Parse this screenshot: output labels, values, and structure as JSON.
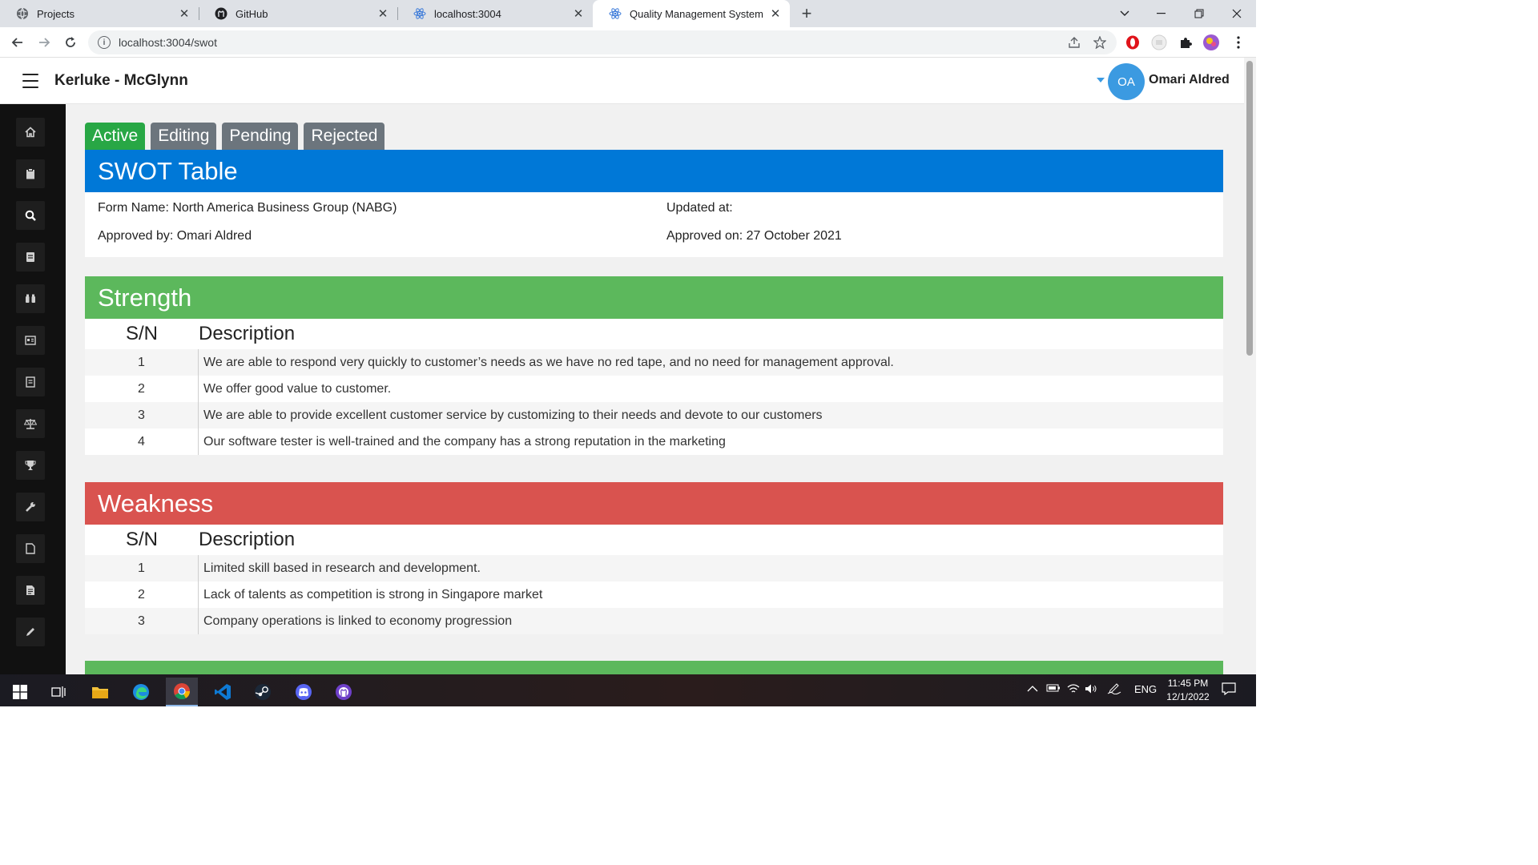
{
  "browser": {
    "tabs": [
      {
        "title": "Projects",
        "icon": "globe-icon"
      },
      {
        "title": "GitHub",
        "icon": "github-icon"
      },
      {
        "title": "localhost:3004",
        "icon": "react-icon"
      },
      {
        "title": "Quality Management System",
        "icon": "react-icon"
      }
    ],
    "close_glyph": "✕",
    "new_tab_glyph": "+",
    "url": "localhost:3004/swot"
  },
  "header": {
    "company": "Kerluke - McGlynn",
    "user_initials": "OA",
    "user_name": "Omari Aldred"
  },
  "sidebar": {
    "items": [
      "home-icon",
      "clipboard-icon",
      "search-icon",
      "document-icon",
      "binoculars-icon",
      "id-card-icon",
      "report-icon",
      "balance-scale-icon",
      "trophy-icon",
      "wrench-icon",
      "file-icon",
      "file-text-icon",
      "pencil-icon"
    ]
  },
  "status_tabs": {
    "active": "Active",
    "editing": "Editing",
    "pending": "Pending",
    "rejected": "Rejected"
  },
  "swot": {
    "title": "SWOT Table",
    "form_name": "Form Name: North America Business Group (NABG)",
    "updated_at": "Updated at:",
    "approved_by": "Approved by: Omari Aldred",
    "approved_on": "Approved on: 27 October 2021"
  },
  "columns": {
    "sn": "S/N",
    "description": "Description"
  },
  "strength": {
    "title": "Strength",
    "rows": [
      {
        "sn": "1",
        "description": "We are able to respond very quickly to customer’s needs as we have no red tape, and no need for management approval."
      },
      {
        "sn": "2",
        "description": "We offer good value to customer."
      },
      {
        "sn": "3",
        "description": "We are able to provide excellent customer service by customizing to their needs and devote to our customers"
      },
      {
        "sn": "4",
        "description": "Our software tester is well-trained and the company has a strong reputation in the marketing"
      }
    ]
  },
  "weakness": {
    "title": "Weakness",
    "rows": [
      {
        "sn": "1",
        "description": "Limited skill based in research and development."
      },
      {
        "sn": "2",
        "description": "Lack of talents as competition is strong in Singapore market"
      },
      {
        "sn": "3",
        "description": "Company operations is linked to economy progression"
      }
    ]
  },
  "colors": {
    "blue_header": "#0078d7",
    "strength_green": "#5cb85c",
    "weakness_red": "#d9534f",
    "active_tab": "#28a745",
    "inactive_tab": "#6c757d",
    "avatar": "#3b9ae1"
  },
  "taskbar": {
    "language": "ENG",
    "time": "11:45 PM",
    "date": "12/1/2022"
  }
}
